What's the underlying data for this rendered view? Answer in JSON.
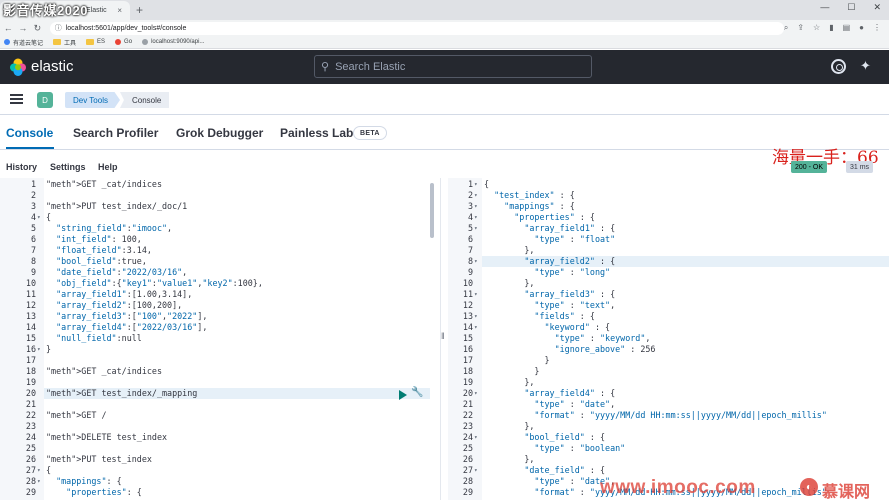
{
  "browser": {
    "watermark": "影音传媒2020",
    "tab_title": "Elastic",
    "tab_close": "×",
    "new_tab": "+",
    "url": "localhost:5601/app/dev_tools#/console",
    "bookmarks": [
      "有道云笔记",
      "工具",
      "ES",
      "Go",
      "localhost:9090/api..."
    ]
  },
  "header": {
    "brand": "elastic",
    "search_placeholder": "Search Elastic"
  },
  "breadcrumb": {
    "space_initial": "D",
    "items": [
      "Dev Tools",
      "Console"
    ]
  },
  "tabs": [
    {
      "label": "Console",
      "active": true
    },
    {
      "label": "Search Profiler"
    },
    {
      "label": "Grok Debugger"
    },
    {
      "label": "Painless Lab"
    }
  ],
  "beta_badge": "BETA",
  "menu": [
    "History",
    "Settings",
    "Help"
  ],
  "overlay_text": "海量一手：66",
  "response": {
    "status": "200 - OK",
    "time": "31 ms"
  },
  "request_lines": [
    {
      "n": "1",
      "t": "GET _cat/indices"
    },
    {
      "n": "2",
      "t": ""
    },
    {
      "n": "3",
      "t": "PUT test_index/_doc/1"
    },
    {
      "n": "4",
      "t": "{",
      "fold": true
    },
    {
      "n": "5",
      "t": "  \"string_field\":\"imooc\","
    },
    {
      "n": "6",
      "t": "  \"int_field\": 100,"
    },
    {
      "n": "7",
      "t": "  \"float_field\":3.14,"
    },
    {
      "n": "8",
      "t": "  \"bool_field\":true,"
    },
    {
      "n": "9",
      "t": "  \"date_field\":\"2022/03/16\","
    },
    {
      "n": "10",
      "t": "  \"obj_field\":{\"key1\":\"value1\",\"key2\":100},"
    },
    {
      "n": "11",
      "t": "  \"array_field1\":[1.00,3.14],"
    },
    {
      "n": "12",
      "t": "  \"array_field2\":[100,200],"
    },
    {
      "n": "13",
      "t": "  \"array_field3\":[\"100\",\"2022\"],"
    },
    {
      "n": "14",
      "t": "  \"array_field4\":[\"2022/03/16\"],"
    },
    {
      "n": "15",
      "t": "  \"null_field\":null"
    },
    {
      "n": "16",
      "t": "}",
      "fold": true
    },
    {
      "n": "17",
      "t": ""
    },
    {
      "n": "18",
      "t": "GET _cat/indices"
    },
    {
      "n": "19",
      "t": ""
    },
    {
      "n": "20",
      "t": "GET test_index/_mapping",
      "hl": true
    },
    {
      "n": "21",
      "t": ""
    },
    {
      "n": "22",
      "t": "GET /"
    },
    {
      "n": "23",
      "t": ""
    },
    {
      "n": "24",
      "t": "DELETE test_index"
    },
    {
      "n": "25",
      "t": ""
    },
    {
      "n": "26",
      "t": "PUT test_index"
    },
    {
      "n": "27",
      "t": "{",
      "fold": true
    },
    {
      "n": "28",
      "t": "  \"mappings\": {",
      "fold": true
    },
    {
      "n": "29",
      "t": "    \"properties\": {"
    }
  ],
  "response_lines": [
    {
      "n": "1",
      "t": "{",
      "fold": true
    },
    {
      "n": "2",
      "t": "  \"test_index\" : {",
      "fold": true
    },
    {
      "n": "3",
      "t": "    \"mappings\" : {",
      "fold": true
    },
    {
      "n": "4",
      "t": "      \"properties\" : {",
      "fold": true
    },
    {
      "n": "5",
      "t": "        \"array_field1\" : {",
      "fold": true
    },
    {
      "n": "6",
      "t": "          \"type\" : \"float\""
    },
    {
      "n": "7",
      "t": "        },"
    },
    {
      "n": "8",
      "t": "        \"array_field2\" : {",
      "fold": true,
      "hl": true
    },
    {
      "n": "9",
      "t": "          \"type\" : \"long\""
    },
    {
      "n": "10",
      "t": "        },"
    },
    {
      "n": "11",
      "t": "        \"array_field3\" : {",
      "fold": true
    },
    {
      "n": "12",
      "t": "          \"type\" : \"text\","
    },
    {
      "n": "13",
      "t": "          \"fields\" : {",
      "fold": true
    },
    {
      "n": "14",
      "t": "            \"keyword\" : {",
      "fold": true
    },
    {
      "n": "15",
      "t": "              \"type\" : \"keyword\","
    },
    {
      "n": "16",
      "t": "              \"ignore_above\" : 256"
    },
    {
      "n": "17",
      "t": "            }"
    },
    {
      "n": "18",
      "t": "          }"
    },
    {
      "n": "19",
      "t": "        },"
    },
    {
      "n": "20",
      "t": "        \"array_field4\" : {",
      "fold": true
    },
    {
      "n": "21",
      "t": "          \"type\" : \"date\","
    },
    {
      "n": "22",
      "t": "          \"format\" : \"yyyy/MM/dd HH:mm:ss||yyyy/MM/dd||epoch_millis\""
    },
    {
      "n": "23",
      "t": "        },"
    },
    {
      "n": "24",
      "t": "        \"bool_field\" : {",
      "fold": true
    },
    {
      "n": "25",
      "t": "          \"type\" : \"boolean\""
    },
    {
      "n": "26",
      "t": "        },"
    },
    {
      "n": "27",
      "t": "        \"date_field\" : {",
      "fold": true
    },
    {
      "n": "28",
      "t": "          \"type\" : \"date\","
    },
    {
      "n": "29",
      "t": "          \"format\" : \"yyyy/MM/dd HH:mm:ss||yyyy/MM/dd||epoch_millis\""
    }
  ],
  "watermark_bottom": "www.imooc.com",
  "watermark_logo_text": "慕课网"
}
